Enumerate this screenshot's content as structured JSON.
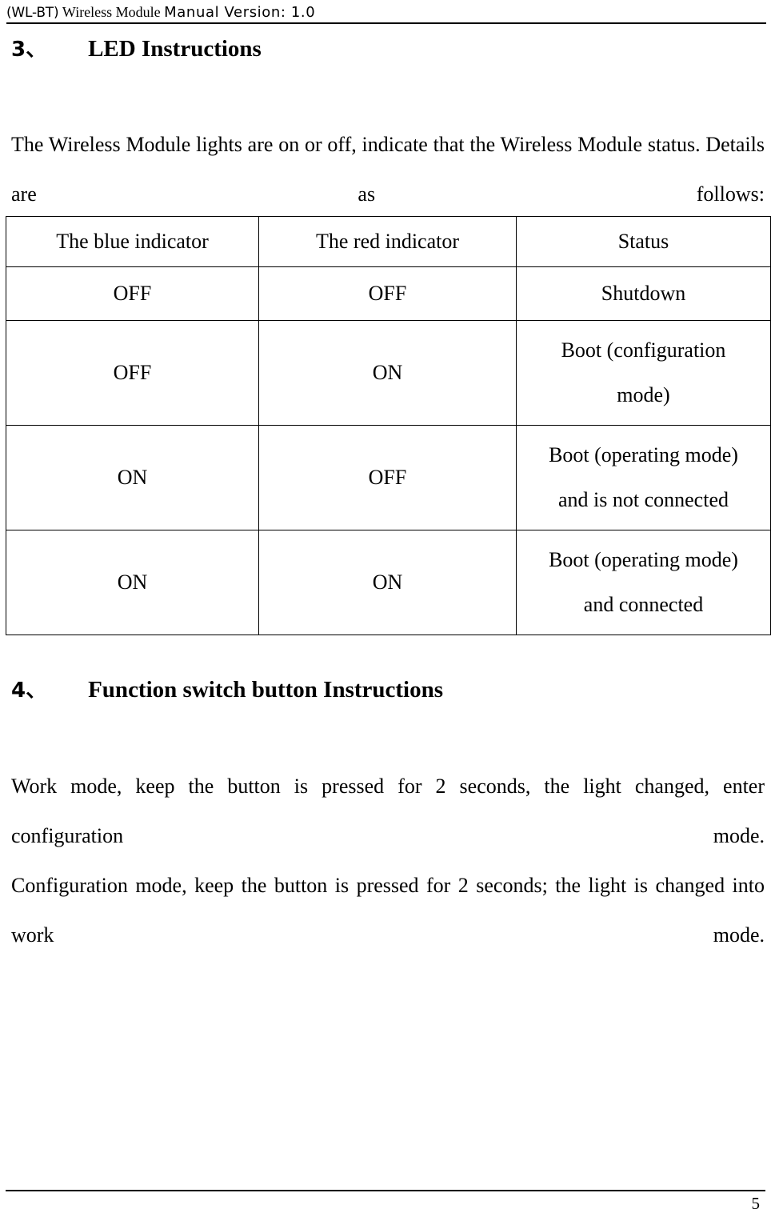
{
  "header": {
    "model": "(WL-BT)",
    "product": "Wireless Module",
    "manual_version": "Manual Version: 1.0"
  },
  "sections": [
    {
      "number": "3、",
      "title": "LED Instructions",
      "intro": "The Wireless Module lights are on or off, indicate that the Wireless Module status. Details are as follows:"
    },
    {
      "number": "4、",
      "title": "Function switch button Instructions",
      "paragraphs": [
        "Work mode, keep the button is pressed for 2 seconds, the light changed, enter configuration mode.",
        "Configuration mode, keep the button is pressed for 2 seconds; the light is changed into work mode."
      ]
    }
  ],
  "led_table": {
    "headers": [
      "The blue indicator",
      "The red indicator",
      "Status"
    ],
    "rows": [
      {
        "blue": "OFF",
        "red": "OFF",
        "status_line1": "Shutdown",
        "status_line2": ""
      },
      {
        "blue": "OFF",
        "red": "ON",
        "status_line1": "Boot (configuration",
        "status_line2": "mode)"
      },
      {
        "blue": "ON",
        "red": "OFF",
        "status_line1": "Boot (operating mode)",
        "status_line2": "and is not connected"
      },
      {
        "blue": "ON",
        "red": "ON",
        "status_line1": "Boot (operating mode)",
        "status_line2": "and connected"
      }
    ]
  },
  "footer": {
    "page_number": "5"
  }
}
